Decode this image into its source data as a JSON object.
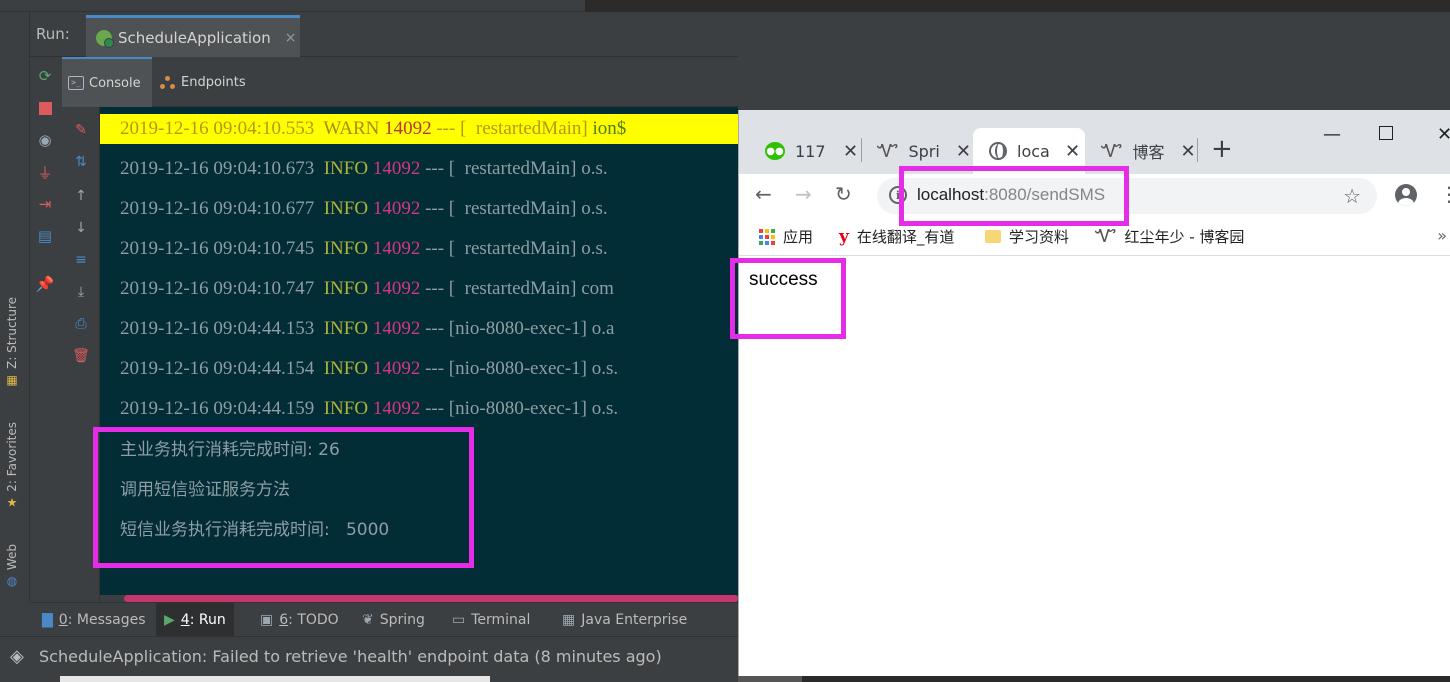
{
  "ide": {
    "run_label": "Run:",
    "run_tab_title": "ScheduleApplication",
    "run_tab_close": "×",
    "subtabs": [
      "Console",
      "Endpoints"
    ],
    "side_tabs": [
      "Z: Structure",
      "2: Favorites",
      "Web"
    ],
    "warn_line": {
      "ts": "2019-12-16 09:04:10.553",
      "level": "WARN",
      "pid": "14092",
      "sep": "--- [",
      "thread": "  restartedMain]",
      "cls": "ion$"
    },
    "log_lines": [
      {
        "ts": "2019-12-16 09:04:10.673",
        "level": "INFO",
        "pid": "14092",
        "sep": "--- [",
        "thread": "  restartedMain]",
        "cls": "o.s."
      },
      {
        "ts": "2019-12-16 09:04:10.677",
        "level": "INFO",
        "pid": "14092",
        "sep": "--- [",
        "thread": "  restartedMain]",
        "cls": "o.s."
      },
      {
        "ts": "2019-12-16 09:04:10.745",
        "level": "INFO",
        "pid": "14092",
        "sep": "--- [",
        "thread": "  restartedMain]",
        "cls": "o.s."
      },
      {
        "ts": "2019-12-16 09:04:10.747",
        "level": "INFO",
        "pid": "14092",
        "sep": "--- [",
        "thread": "  restartedMain]",
        "cls": "com"
      },
      {
        "ts": "2019-12-16 09:04:44.153",
        "level": "INFO",
        "pid": "14092",
        "sep": "--- [",
        "thread": "nio-8080-exec-1]",
        "cls": "o.a"
      },
      {
        "ts": "2019-12-16 09:04:44.154",
        "level": "INFO",
        "pid": "14092",
        "sep": "--- [",
        "thread": "nio-8080-exec-1]",
        "cls": "o.s."
      },
      {
        "ts": "2019-12-16 09:04:44.159",
        "level": "INFO",
        "pid": "14092",
        "sep": "--- [",
        "thread": "nio-8080-exec-1]",
        "cls": "o.s."
      }
    ],
    "output_lines": [
      "主业务执行消耗完成时间: 26",
      "调用短信验证服务方法",
      "短信业务执行消耗完成时间:   5000"
    ],
    "bottom_tabs": [
      {
        "num": "0",
        "label": ": Messages"
      },
      {
        "num": "4",
        "label": ": Run"
      },
      {
        "num": "6",
        "label": ": TODO"
      },
      {
        "num": "",
        "label": "Spring"
      },
      {
        "num": "",
        "label": "Terminal"
      },
      {
        "num": "",
        "label": "Java Enterprise"
      }
    ],
    "status_text": "ScheduleApplication: Failed to retrieve 'health' endpoint data (8 minutes ago)"
  },
  "browser": {
    "tabs": [
      {
        "title": "117.",
        "icon": "wechat-icon"
      },
      {
        "title": "Sprin",
        "icon": "cnblogs-icon"
      },
      {
        "title": "local",
        "icon": "globe-icon"
      },
      {
        "title": "博客",
        "icon": "cnblogs-icon"
      }
    ],
    "tab_close": "✕",
    "new_tab": "+",
    "url_host": "localhost",
    "url_rest": ":8080/sendSMS",
    "bookmarks": [
      "应用",
      "在线翻译_有道",
      "学习资料",
      "红尘年少 - 博客园"
    ],
    "bookmarks_more": "»",
    "page_text": "success"
  },
  "colors": {
    "console_bg": "#022c36",
    "highlight": "#e52de8",
    "warn_bg": "#ffff00",
    "pid": "#d33682",
    "info": "#b0b43a"
  }
}
